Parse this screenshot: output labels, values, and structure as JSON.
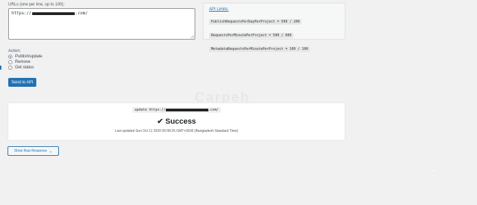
{
  "urls": {
    "label": "URLs (one per line, up to 100):",
    "value_prefix": "https://",
    "value_suffix": ".com/"
  },
  "api_limits": {
    "title": "API Limits:",
    "rows": [
      "PublishRequestsPerDayPerProject = 599 / 200",
      "RequestsPerMinutePerProject = 500 / 600",
      "MetadataRequestsPerMinutePerProject = 100 / 100"
    ]
  },
  "action": {
    "label": "Action:",
    "options": [
      {
        "label": "Publish/update",
        "checked": true
      },
      {
        "label": "Remove",
        "checked": false
      },
      {
        "label": "Get status",
        "checked": false
      }
    ]
  },
  "send_button": "Send to API",
  "result": {
    "command": "update",
    "url_prefix": "https://",
    "url_suffix": ".com/",
    "status": "Success",
    "last_updated": "Last updated Sun Oct 11 2020 00:08:25 GMT+0600 (Bangladesh Standard Time)"
  },
  "raw_response_button": "Show Raw Response",
  "watermark": "Carpeh",
  "colors": {
    "accent": "#2271b1",
    "background": "#f1f1f1",
    "panel": "#ffffff"
  }
}
